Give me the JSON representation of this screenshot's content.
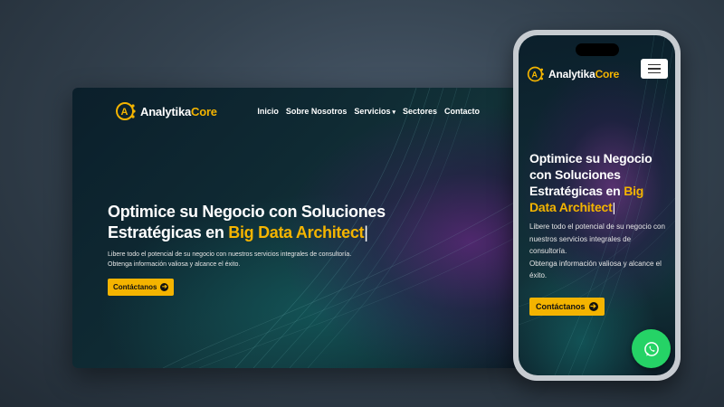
{
  "brand": {
    "name_part1": "Analytika",
    "name_part2": "Core"
  },
  "nav": {
    "items": [
      "Inicio",
      "Sobre Nosotros",
      "Servicios",
      "Sectores",
      "Contacto"
    ],
    "dropdown_indicator": "▾"
  },
  "hero": {
    "title_line": "Optimice su Negocio con Soluciones Estratégicas en",
    "title_highlight": "Big Data Architect",
    "cursor": "|",
    "desktop_description_1": "Libere todo el potencial de su negocio con nuestros servicios integrales de consultoría.",
    "desktop_description_2": "Obtenga información valiosa y alcance el éxito.",
    "mobile_description_1": "Libere todo el potencial de su negocio con nuestros servicios integrales de consultoría.",
    "mobile_description_2": "Obtenga información valiosa y alcance el éxito.",
    "cta_label": "Contáctanos"
  },
  "icons": {
    "logo": "analytika-logo-icon",
    "cta_arrow": "arrow-right-circle-icon",
    "menu": "hamburger-menu-icon",
    "chat": "whatsapp-icon"
  },
  "colors": {
    "accent": "#f4b400",
    "whatsapp": "#25d366",
    "background_dark": "#0f2a33"
  }
}
